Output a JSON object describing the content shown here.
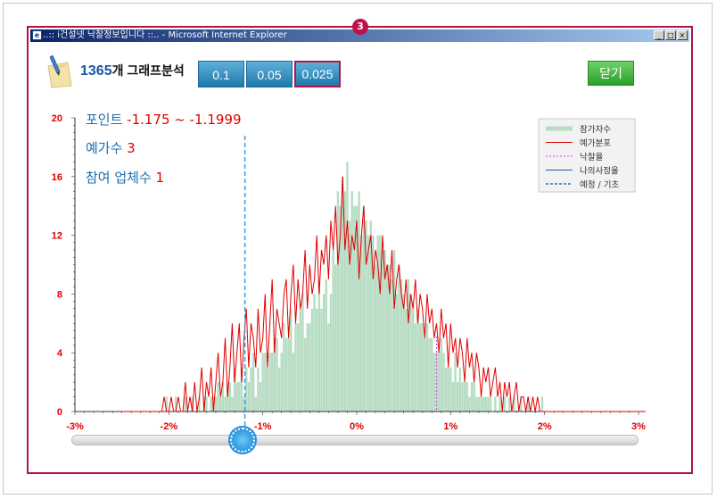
{
  "window": {
    "title": "..:: i건설넷 낙찰정보입니다 ::.. - Microsoft Internet Explorer",
    "badge": "3",
    "minimize": "_",
    "maximize": "□",
    "close": "×",
    "browser_icon": "ie-icon"
  },
  "header": {
    "count": "1365",
    "count_suffix": "개 그래프분석",
    "logo_icon": "pencil-note-icon"
  },
  "range_buttons": [
    {
      "label": "0.1",
      "selected": false
    },
    {
      "label": "0.05",
      "selected": false
    },
    {
      "label": "0.025",
      "selected": true
    }
  ],
  "close_button": "닫기",
  "info": {
    "point_label": "포인트",
    "point_value": "-1.175 ~ -1.1999",
    "estimate_label": "예가수",
    "estimate_value": "3",
    "participants_label": "참여 업체수",
    "participants_value": "1"
  },
  "slider": {
    "value_percent": -1.2,
    "range": [
      -3,
      3
    ]
  },
  "colors": {
    "frame": "#b0154a",
    "bars": "#b6dcc3",
    "line": "#e00000",
    "axis_labels": "#e00000",
    "info_blue": "#1a6fb0",
    "marker_blue": "#3a9ee4",
    "marker_pink": "#d24fd2"
  },
  "chart_data": {
    "type": "bar",
    "xlabel": "",
    "ylabel": "",
    "xlim": [
      -3,
      3
    ],
    "ylim": [
      0,
      20
    ],
    "x_ticks": [
      "-3%",
      "-2%",
      "-1%",
      "0%",
      "1%",
      "2%",
      "3%"
    ],
    "y_ticks": [
      "0",
      "4",
      "8",
      "12",
      "16",
      "20"
    ],
    "grid": false,
    "legend_position": "top-right",
    "legend": [
      {
        "label": "참가자수",
        "style": "bar"
      },
      {
        "label": "예가분포",
        "style": "red-line"
      },
      {
        "label": "낙찰율",
        "style": "pink-dashed"
      },
      {
        "label": "나의사정율",
        "style": "blue-line"
      },
      {
        "label": "예정 / 기초",
        "style": "blue-dashed"
      }
    ],
    "markers": {
      "estimate_basis": -1.19,
      "winning_rate": 0.85
    },
    "bin_width": 0.025,
    "series": [
      {
        "name": "참가자수",
        "style": "bars",
        "x_start": -2.45,
        "values": [
          0,
          0,
          0,
          0,
          0,
          0,
          0,
          0,
          0,
          0,
          0,
          0,
          0,
          0,
          0,
          0,
          0,
          1,
          0,
          0,
          0,
          1,
          0,
          0,
          0,
          1,
          0,
          0,
          1,
          0,
          0,
          1,
          0,
          1,
          1,
          0,
          1,
          1,
          1,
          2,
          1,
          2,
          1,
          2,
          2,
          1,
          3,
          2,
          2,
          3,
          1,
          3,
          2,
          3,
          4,
          1,
          3,
          2,
          4,
          4,
          3,
          4,
          4,
          5,
          5,
          3,
          4,
          6,
          5,
          5,
          7,
          4,
          6,
          6,
          7,
          8,
          5,
          6,
          6,
          7,
          8,
          7,
          9,
          7,
          8,
          9,
          6,
          8,
          11,
          10,
          15,
          14,
          16,
          15,
          17,
          13,
          15,
          14,
          14,
          15,
          12,
          14,
          13,
          12,
          13,
          12,
          10,
          12,
          12,
          11,
          11,
          10,
          10,
          9,
          11,
          8,
          10,
          9,
          8,
          7,
          9,
          8,
          7,
          6,
          7,
          6,
          6,
          5,
          6,
          5,
          5,
          4,
          4,
          4,
          5,
          4,
          3,
          3,
          3,
          2,
          4,
          2,
          3,
          2,
          2,
          2,
          1,
          2,
          2,
          1,
          1,
          1,
          1,
          1,
          1,
          1,
          0,
          1,
          0,
          1,
          0,
          1,
          0,
          1,
          0,
          1,
          0,
          0,
          1,
          0,
          0,
          1,
          0,
          0,
          0,
          0,
          0,
          1,
          0,
          0,
          0,
          0,
          0,
          0,
          0,
          0,
          0,
          0,
          0,
          0,
          0,
          0
        ]
      },
      {
        "name": "예가분포",
        "style": "line",
        "x_start": -2.5,
        "values": [
          0,
          0,
          0,
          0,
          0,
          0,
          0,
          0,
          0,
          0,
          0,
          0,
          0,
          0,
          0,
          0,
          0,
          0,
          1,
          0,
          0,
          1,
          0,
          0,
          1,
          0,
          0,
          2,
          0,
          1,
          0,
          2,
          0,
          1,
          3,
          0,
          2,
          1,
          3,
          0,
          2,
          4,
          1,
          2,
          5,
          1,
          3,
          6,
          2,
          4,
          6,
          2,
          5,
          7,
          3,
          6,
          5,
          3,
          7,
          4,
          5,
          8,
          3,
          6,
          9,
          4,
          7,
          6,
          5,
          8,
          9,
          5,
          8,
          10,
          6,
          9,
          7,
          8,
          11,
          7,
          10,
          8,
          9,
          12,
          8,
          11,
          10,
          12,
          9,
          13,
          11,
          14,
          10,
          12,
          16,
          11,
          13,
          10,
          12,
          11,
          13,
          9,
          12,
          14,
          10,
          11,
          12,
          9,
          11,
          10,
          8,
          12,
          9,
          10,
          8,
          11,
          7,
          9,
          10,
          8,
          7,
          9,
          6,
          8,
          7,
          9,
          6,
          8,
          7,
          5,
          8,
          6,
          7,
          5,
          6,
          4,
          7,
          5,
          6,
          3,
          6,
          4,
          5,
          3,
          5,
          4,
          2,
          5,
          3,
          4,
          2,
          4,
          3,
          1,
          3,
          2,
          3,
          1,
          2,
          3,
          1,
          2,
          0,
          2,
          1,
          2,
          0,
          1,
          2,
          0,
          1,
          1,
          0,
          1,
          0,
          1,
          0,
          1,
          0,
          0,
          0,
          0,
          0,
          0,
          0,
          0,
          0,
          0,
          0,
          0,
          0,
          0,
          0,
          0,
          0,
          0,
          0,
          0,
          0,
          0,
          0,
          0,
          0,
          0,
          0,
          0,
          0,
          0,
          0,
          0,
          0,
          0,
          0,
          0,
          0,
          0,
          0,
          0,
          0,
          0,
          0,
          0,
          0,
          0
        ]
      }
    ]
  }
}
